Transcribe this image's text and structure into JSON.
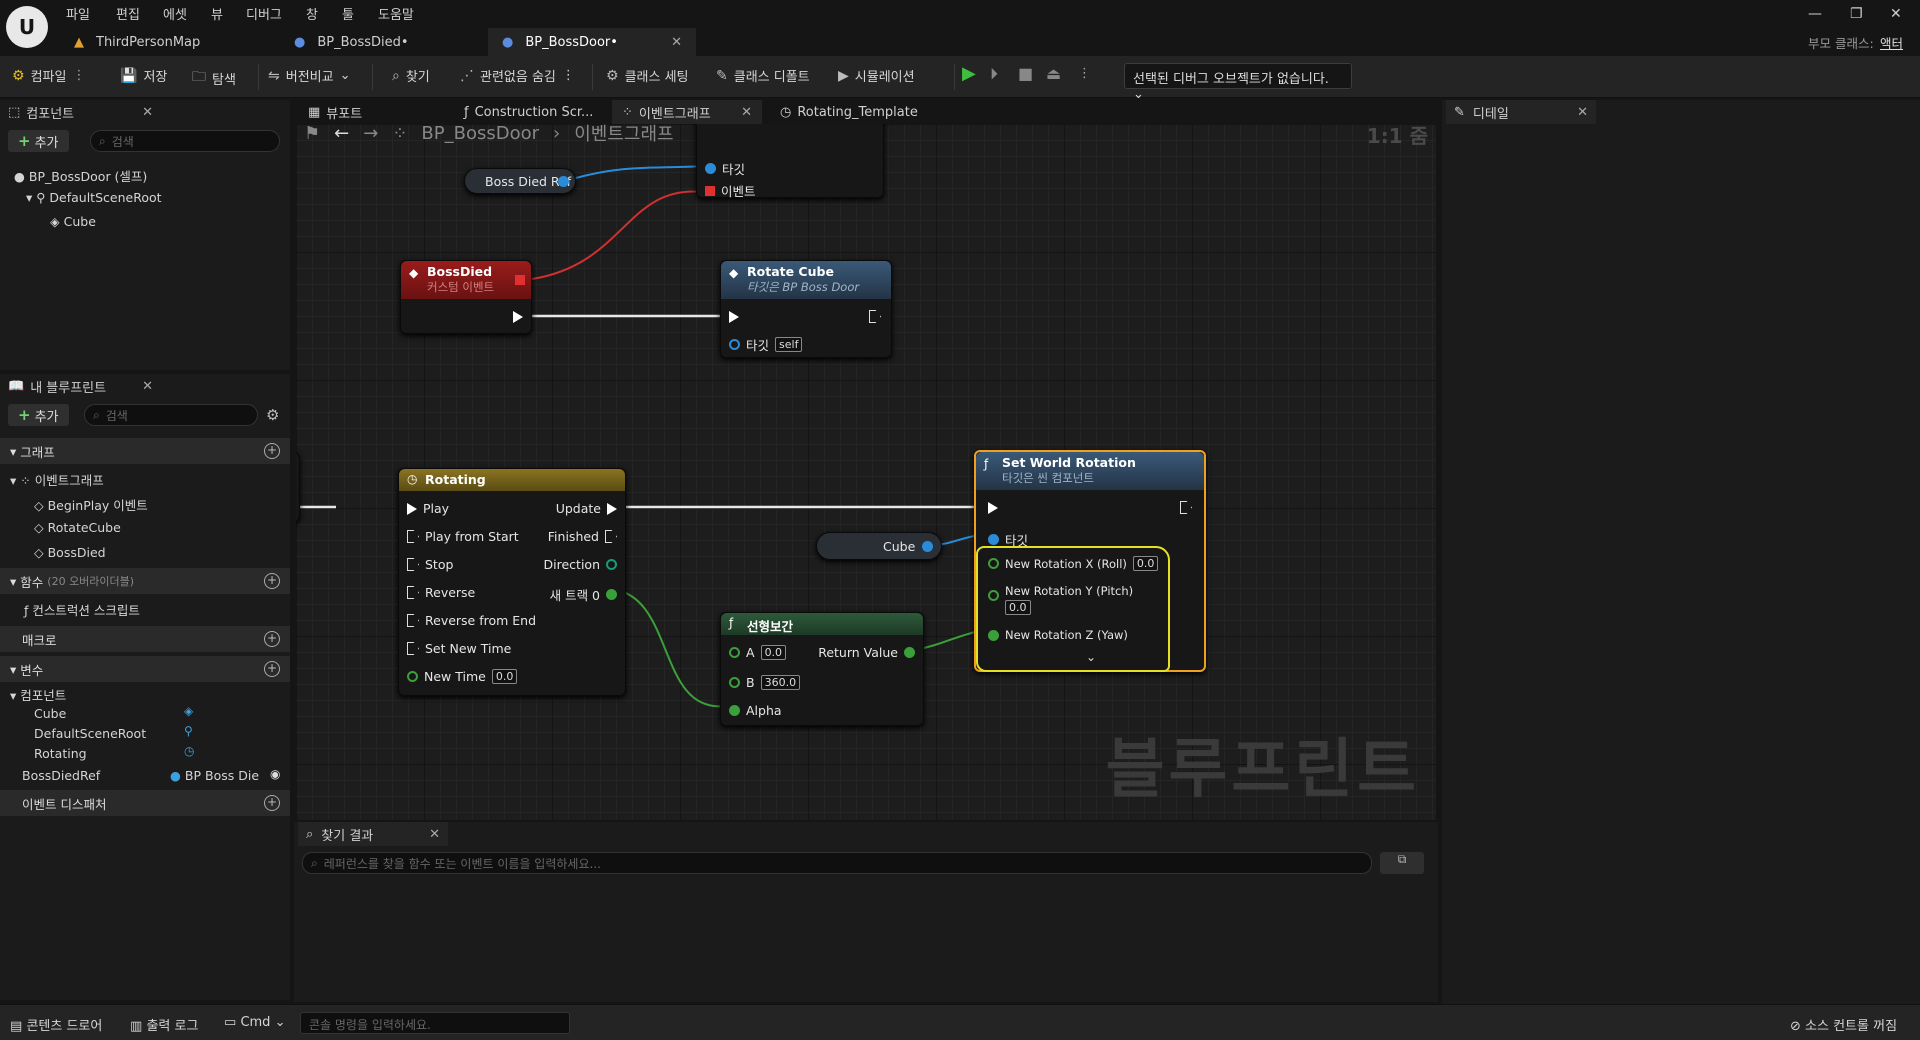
{
  "menu": [
    "파일",
    "편집",
    "에셋",
    "뷰",
    "디버그",
    "창",
    "툴",
    "도움말"
  ],
  "doc_tabs": [
    "ThirdPersonMap",
    "BP_BossDied•",
    "BP_BossDoor•"
  ],
  "parent_class": {
    "label": "부모 클래스:",
    "value": "액터"
  },
  "toolbar": {
    "compile": "컴파일",
    "save": "저장",
    "browse": "탐색",
    "diff": "버전비교",
    "find": "찾기",
    "hide_unrelated": "관련없음 숨김",
    "class_settings": "클래스 세팅",
    "class_defaults": "클래스 디폴트",
    "simulation": "시뮬레이션",
    "debug_select": "선택된 디버그 오브젝트가 없습니다."
  },
  "components_panel": {
    "title": "컴포넌트",
    "add": "추가",
    "search": "검색",
    "root": "BP_BossDoor (셀프)",
    "scene_root": "DefaultSceneRoot",
    "cube": "Cube"
  },
  "myblueprint": {
    "title": "내 블루프린트",
    "add": "추가",
    "search": "검색",
    "graphs": "그래프",
    "event_graph": "이벤트그래프",
    "events": [
      "BeginPlay 이벤트",
      "RotateCube",
      "BossDied"
    ],
    "functions": "함수",
    "functions_sub": "(20 오버라이더블)",
    "construction": "컨스트럭션 스크립트",
    "macros": "매크로",
    "variables": "변수",
    "components_cat": "컴포넌트",
    "vars": [
      "Cube",
      "DefaultSceneRoot",
      "Rotating"
    ],
    "boss_ref": "BossDiedRef",
    "boss_ref_type": "BP Boss Die",
    "dispatchers": "이벤트 디스패처"
  },
  "graph_tabs": [
    "뷰포트",
    "Construction Scr...",
    "이벤트그래프",
    "Rotating_Template"
  ],
  "breadcrumb": {
    "bp": "BP_BossDoor",
    "graph": "이벤트그래프",
    "zoom": "1:1 줌"
  },
  "details": {
    "title": "디테일"
  },
  "nodes": {
    "bind_pins": {
      "target": "타깃",
      "event": "이벤트"
    },
    "boss_ref": "Boss Died Ref",
    "bossdied": {
      "title": "BossDied",
      "sub": "커스텀 이벤트"
    },
    "rotate": {
      "title": "Rotate Cube",
      "sub": "타깃은 BP Boss Door",
      "target": "타깃",
      "self": "self"
    },
    "rotating": {
      "title": "Rotating",
      "inputs": [
        "Play",
        "Play from Start",
        "Stop",
        "Reverse",
        "Reverse from End",
        "Set New Time"
      ],
      "new_time": "New Time",
      "new_time_val": "0.0",
      "outputs": [
        "Update",
        "Finished",
        "Direction",
        "새 트랙 0"
      ]
    },
    "lerp": {
      "title": "선형보간",
      "a": "A",
      "a_val": "0.0",
      "b": "B",
      "b_val": "360.0",
      "alpha": "Alpha",
      "ret": "Return Value"
    },
    "cube": "Cube",
    "swr": {
      "title": "Set World Rotation",
      "sub": "타깃은 씬 컴포넌트",
      "target": "타깃",
      "x": "New Rotation X (Roll)",
      "x_val": "0.0",
      "y": "New Rotation Y (Pitch)",
      "y_val": "0.0",
      "z": "New Rotation Z (Yaw)"
    }
  },
  "watermark": "블루프린트",
  "find_results": {
    "title": "찾기 결과",
    "placeholder": "레퍼런스를 찾을 함수 또는 이벤트 이름을 입력하세요..."
  },
  "bottom": {
    "content_drawer": "콘텐츠 드로어",
    "output_log": "출력 로그",
    "cmd": "Cmd",
    "console": "콘솔 명령을 입력하세요.",
    "source_control": "소스 컨트롤 꺼짐"
  }
}
